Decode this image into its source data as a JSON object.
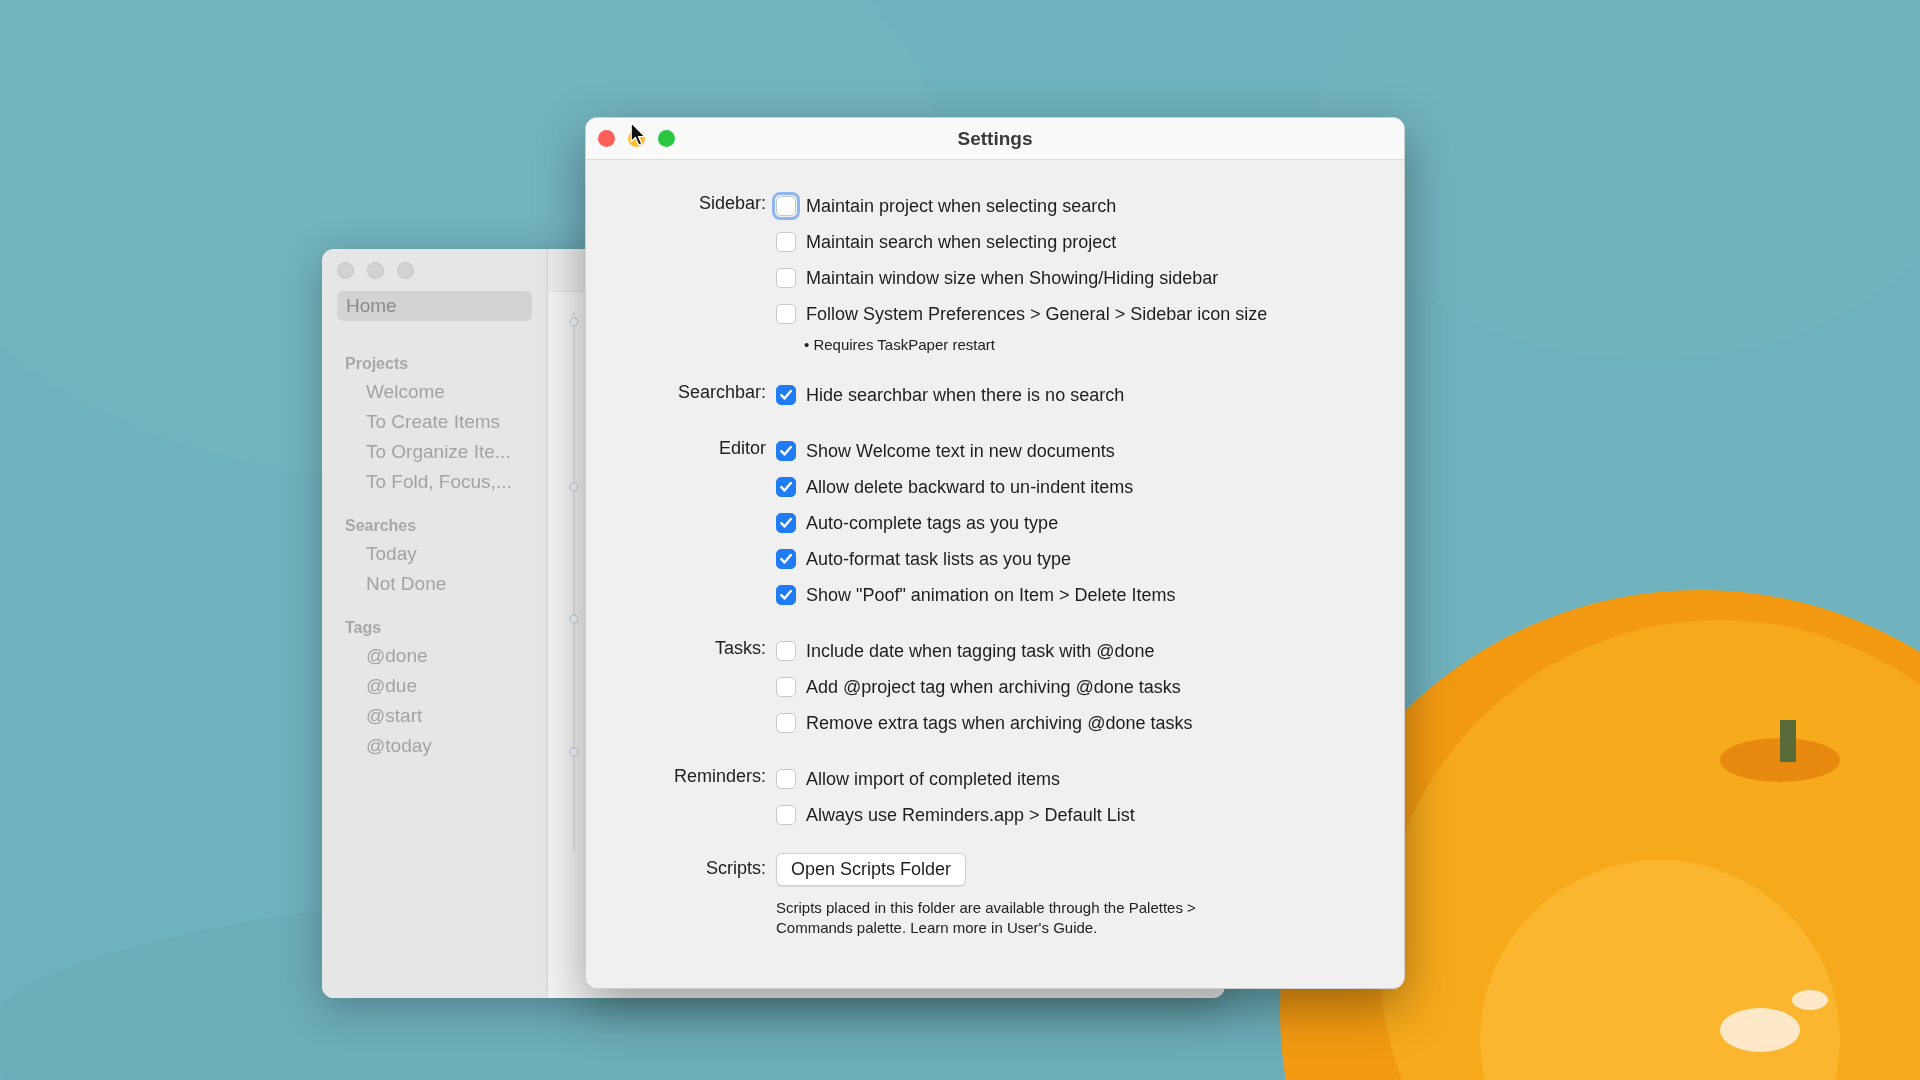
{
  "back_window": {
    "sidebar": {
      "items": [
        {
          "label": "Home",
          "selected": true
        }
      ],
      "sections": [
        {
          "title": "Projects",
          "items": [
            {
              "label": "Welcome",
              "selected": false
            },
            {
              "label": "To Create Items",
              "selected": false
            },
            {
              "label": "To Organize Ite...",
              "selected": false
            },
            {
              "label": "To Fold, Focus,...",
              "selected": false
            }
          ]
        },
        {
          "title": "Searches",
          "items": [
            {
              "label": "Today",
              "selected": false
            },
            {
              "label": "Not Done",
              "selected": false
            }
          ]
        },
        {
          "title": "Tags",
          "items": [
            {
              "label": "@done",
              "selected": false
            },
            {
              "label": "@due",
              "selected": false
            },
            {
              "label": "@start",
              "selected": false
            },
            {
              "label": "@today",
              "selected": false
            }
          ]
        }
      ]
    }
  },
  "settings": {
    "title": "Settings",
    "groups": [
      {
        "label": "Sidebar:",
        "options": [
          {
            "kind": "checkbox",
            "label": "Maintain project when selecting search",
            "checked": false,
            "focused": true
          },
          {
            "kind": "checkbox",
            "label": "Maintain search when selecting project",
            "checked": false,
            "focused": false
          },
          {
            "kind": "checkbox",
            "label": "Maintain window size when Showing/Hiding sidebar",
            "checked": false,
            "focused": false
          },
          {
            "kind": "checkbox",
            "label": "Follow System Preferences > General > Sidebar icon size",
            "checked": false,
            "focused": false
          }
        ],
        "note": "• Requires TaskPaper restart"
      },
      {
        "label": "Searchbar:",
        "options": [
          {
            "kind": "checkbox",
            "label": "Hide searchbar when there is no search",
            "checked": true,
            "focused": false
          }
        ]
      },
      {
        "label": "Editor",
        "options": [
          {
            "kind": "checkbox",
            "label": "Show Welcome text in new documents",
            "checked": true,
            "focused": false
          },
          {
            "kind": "checkbox",
            "label": "Allow delete backward to un-indent items",
            "checked": true,
            "focused": false
          },
          {
            "kind": "checkbox",
            "label": "Auto-complete tags as you type",
            "checked": true,
            "focused": false
          },
          {
            "kind": "checkbox",
            "label": "Auto-format task lists as you type",
            "checked": true,
            "focused": false
          },
          {
            "kind": "checkbox",
            "label": "Show \"Poof\" animation on Item > Delete Items",
            "checked": true,
            "focused": false
          }
        ]
      },
      {
        "label": "Tasks:",
        "options": [
          {
            "kind": "checkbox",
            "label": "Include date when tagging task with @done",
            "checked": false,
            "focused": false
          },
          {
            "kind": "checkbox",
            "label": "Add @project tag when archiving @done tasks",
            "checked": false,
            "focused": false
          },
          {
            "kind": "checkbox",
            "label": "Remove extra tags when archiving @done tasks",
            "checked": false,
            "focused": false
          }
        ]
      },
      {
        "label": "Reminders:",
        "options": [
          {
            "kind": "checkbox",
            "label": "Allow import of completed items",
            "checked": false,
            "focused": false
          },
          {
            "kind": "checkbox",
            "label": "Always use Reminders.app > Default List",
            "checked": false,
            "focused": false
          }
        ]
      },
      {
        "label": "Scripts:",
        "button": "Open Scripts Folder",
        "description": "Scripts placed in this folder are available through the Palettes > Commands palette. Learn more in User's Guide."
      }
    ]
  }
}
